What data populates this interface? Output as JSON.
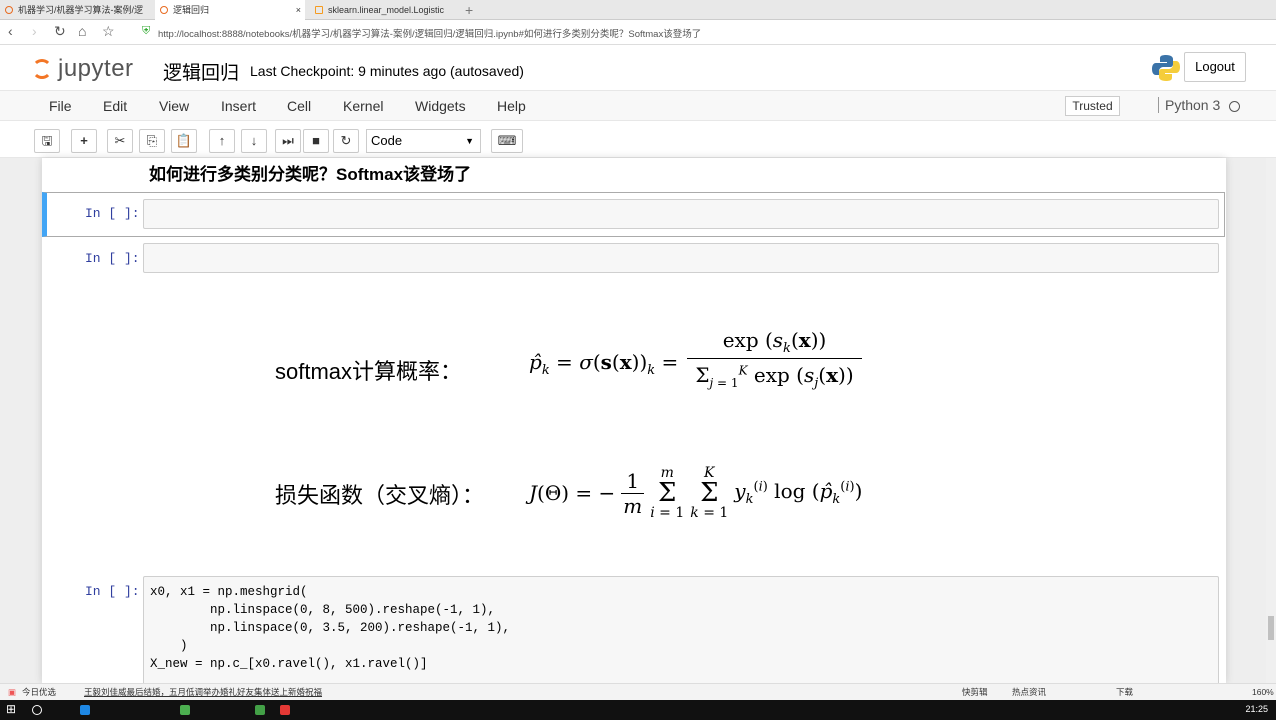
{
  "browser": {
    "tabs": [
      {
        "label": "机器学习/机器学习算法-案例/逻"
      },
      {
        "label": "逻辑回归"
      },
      {
        "label": "sklearn.linear_model.Logistic"
      }
    ],
    "url": "http://localhost:8888/notebooks/机器学习/机器学习算法-案例/逻辑回归/逻辑回归.ipynb#如何进行多类别分类呢？Softmax该登场了"
  },
  "header": {
    "logo": "jupyter",
    "title": "逻辑回归",
    "checkpoint": "Last Checkpoint: 9 minutes ago (autosaved)",
    "logout": "Logout"
  },
  "menu": {
    "items": [
      "File",
      "Edit",
      "View",
      "Insert",
      "Cell",
      "Kernel",
      "Widgets",
      "Help"
    ],
    "trusted": "Trusted",
    "kernel": "Python 3"
  },
  "toolbar": {
    "cell_type": "Code"
  },
  "notebook": {
    "heading": "如何进行多类别分类呢？Softmax该登场了",
    "prompt": "In [ ]:",
    "softmax_label": "softmax计算概率：",
    "loss_label": "损失函数（交叉熵）：",
    "code": [
      "x0, x1 = np.meshgrid(",
      "        np.linspace(0, 8, 500).reshape(-1, 1),",
      "        np.linspace(0, 3.5, 200).reshape(-1, 1),",
      "    )",
      "X_new = np.c_[x0.ravel(), x1.ravel()]"
    ]
  },
  "statusbar": {
    "left": "今日优选",
    "news": "王毅刘佳威最后结婚，五月低调举办婚礼好友集体送上新婚祝福",
    "right": [
      "快剪辑",
      "热点资讯",
      "下载"
    ],
    "zoom": "160%"
  },
  "taskbar": {
    "time": "21:25"
  }
}
